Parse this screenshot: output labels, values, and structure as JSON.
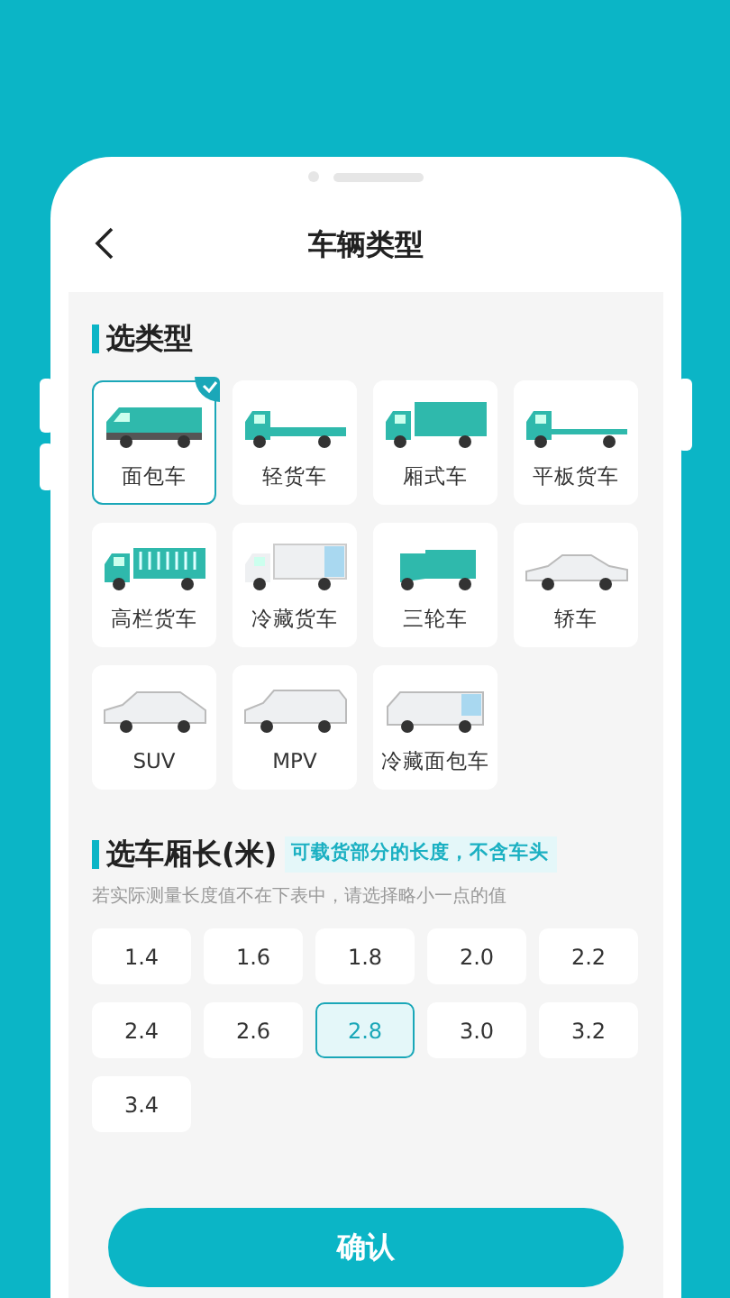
{
  "header": {
    "title": "车辆类型"
  },
  "type_section": {
    "title": "选类型",
    "vehicles": [
      {
        "label": "面包车",
        "kind": "van",
        "selected": true
      },
      {
        "label": "轻货车",
        "kind": "light-truck",
        "selected": false
      },
      {
        "label": "厢式车",
        "kind": "box-truck",
        "selected": false
      },
      {
        "label": "平板货车",
        "kind": "flatbed",
        "selected": false
      },
      {
        "label": "高栏货车",
        "kind": "fence-truck",
        "selected": false
      },
      {
        "label": "冷藏货车",
        "kind": "reefer-truck",
        "selected": false
      },
      {
        "label": "三轮车",
        "kind": "tricycle",
        "selected": false
      },
      {
        "label": "轿车",
        "kind": "sedan",
        "selected": false
      },
      {
        "label": "SUV",
        "kind": "suv",
        "selected": false
      },
      {
        "label": "MPV",
        "kind": "mpv",
        "selected": false
      },
      {
        "label": "冷藏面包车",
        "kind": "reefer-van",
        "selected": false
      }
    ]
  },
  "length_section": {
    "title": "选车厢长(米)",
    "note": "可载货部分的长度，不含车头",
    "hint": "若实际测量长度值不在下表中，请选择略小一点的值",
    "lengths": [
      {
        "label": "1.4",
        "selected": false
      },
      {
        "label": "1.6",
        "selected": false
      },
      {
        "label": "1.8",
        "selected": false
      },
      {
        "label": "2.0",
        "selected": false
      },
      {
        "label": "2.2",
        "selected": false
      },
      {
        "label": "2.4",
        "selected": false
      },
      {
        "label": "2.6",
        "selected": false
      },
      {
        "label": "2.8",
        "selected": true
      },
      {
        "label": "3.0",
        "selected": false
      },
      {
        "label": "3.2",
        "selected": false
      },
      {
        "label": "3.4",
        "selected": false
      }
    ]
  },
  "confirm_button": {
    "label": "确认"
  }
}
